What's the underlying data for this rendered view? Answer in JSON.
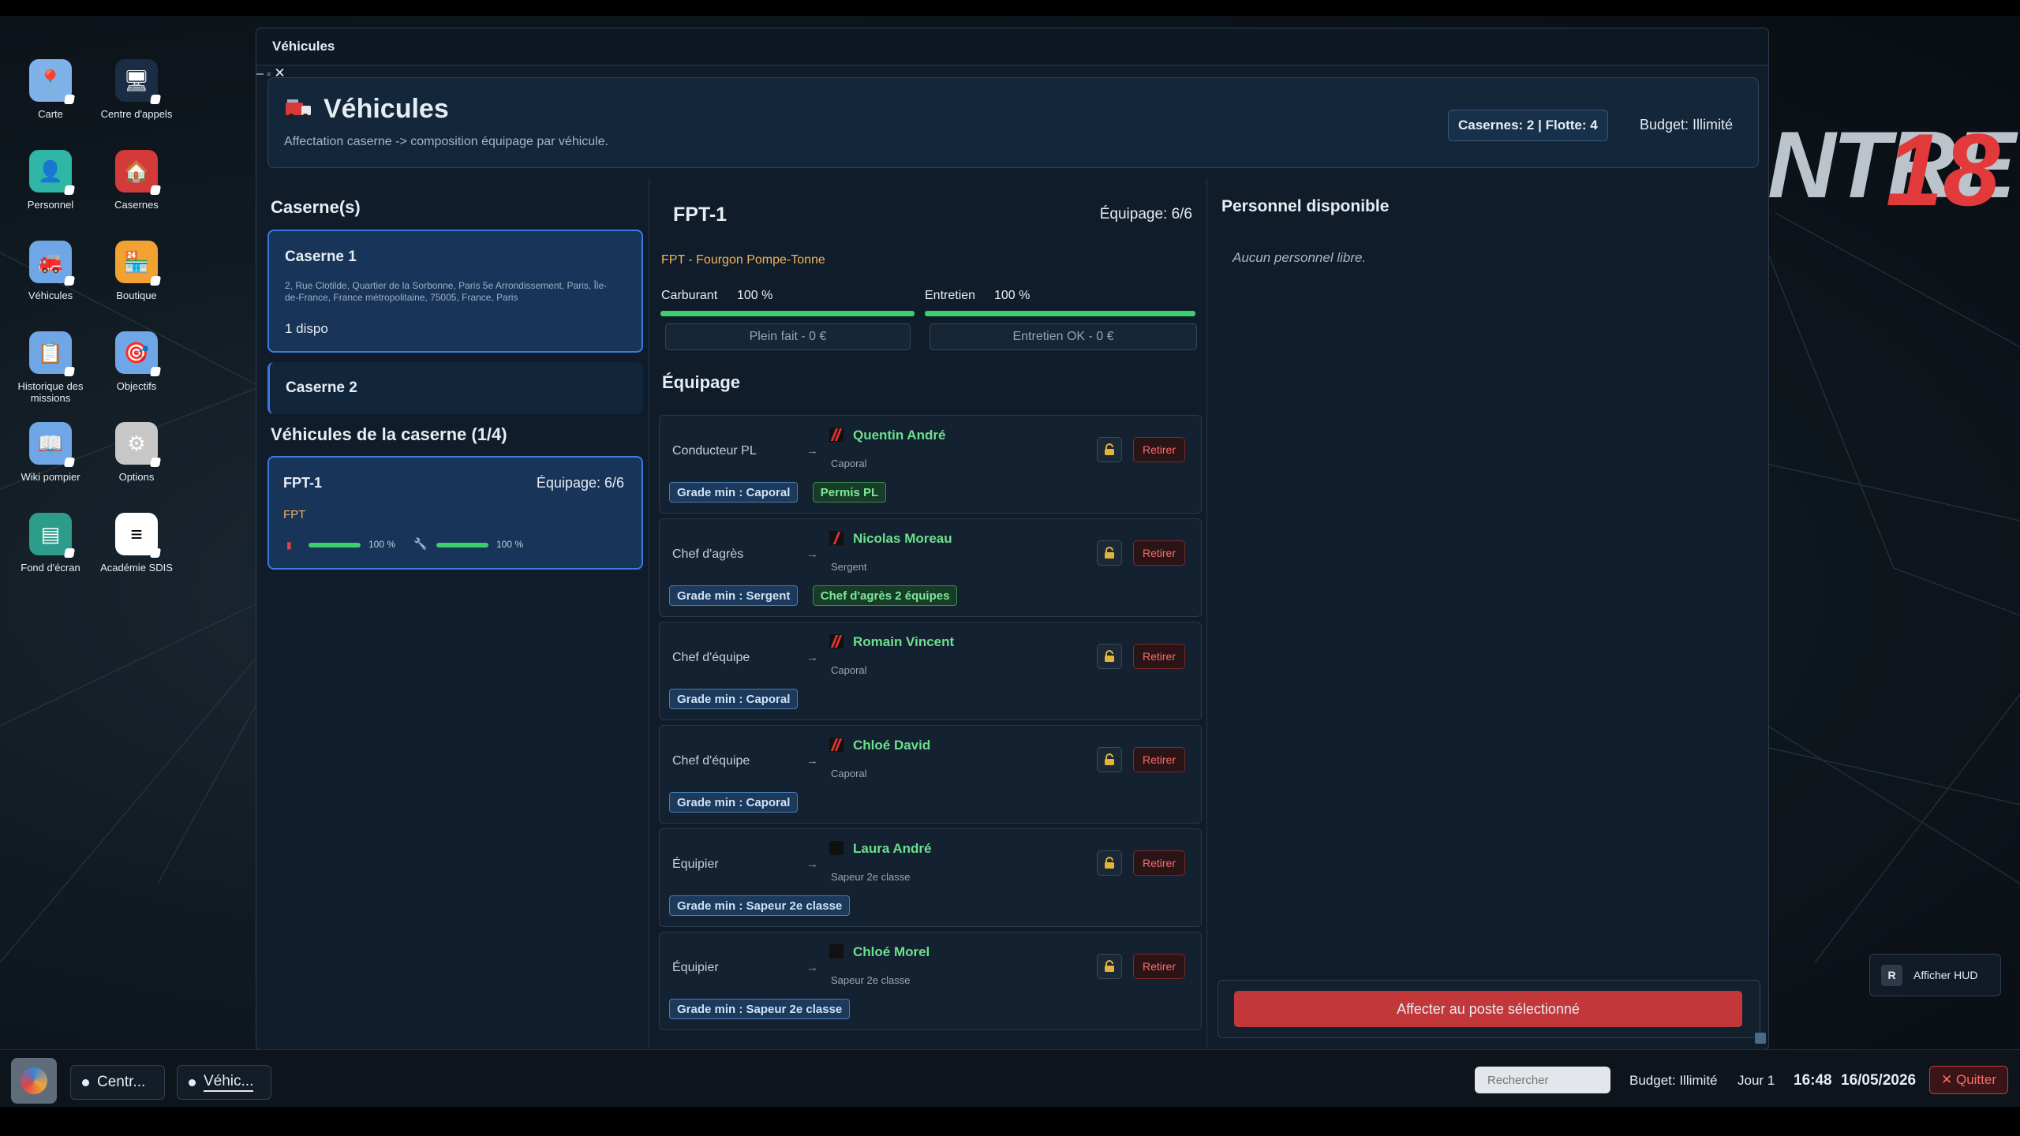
{
  "desktop": {
    "brand_text": "NTRE",
    "brand_num": "18",
    "icons": [
      {
        "label": "Carte",
        "icon": "map-icon"
      },
      {
        "label": "Centre d'appels",
        "icon": "call-center-icon"
      },
      {
        "label": "Personnel",
        "icon": "personnel-icon"
      },
      {
        "label": "Casernes",
        "icon": "firestation-icon"
      },
      {
        "label": "Véhicules",
        "icon": "vehicles-icon"
      },
      {
        "label": "Boutique",
        "icon": "shop-icon"
      },
      {
        "label": "Historique des missions",
        "icon": "history-icon"
      },
      {
        "label": "Objectifs",
        "icon": "objectives-icon"
      },
      {
        "label": "Wiki pompier",
        "icon": "wiki-icon"
      },
      {
        "label": "Options",
        "icon": "gear-icon"
      },
      {
        "label": "Fond d'écran",
        "icon": "wallpaper-icon"
      },
      {
        "label": "Académie SDIS",
        "icon": "academy-icon"
      }
    ]
  },
  "window": {
    "title": "Véhicules",
    "header_title": "Véhicules",
    "header_subtitle": "Affectation caserne -> composition équipage par véhicule.",
    "counts": "Casernes: 2 | Flotte: 4",
    "budget": "Budget: Illimité"
  },
  "stations": {
    "heading": "Caserne(s)",
    "items": [
      {
        "name": "Caserne 1",
        "address": "2, Rue Clotilde, Quartier de la Sorbonne, Paris 5e Arrondissement, Paris, Île-de-France, France métropolitaine, 75005, France, Paris",
        "available": "1 dispo"
      },
      {
        "name": "Caserne 2"
      }
    ]
  },
  "vehicles": {
    "heading": "Véhicules de la caserne (1/4)",
    "items": [
      {
        "name": "FPT-1",
        "crew": "Équipage: 6/6",
        "type": "FPT",
        "fuel_pct": "100 %",
        "maint_pct": "100 %",
        "fuel_level": 1.0,
        "maint_level": 1.0
      }
    ]
  },
  "detail": {
    "name": "FPT-1",
    "crew": "Équipage: 6/6",
    "type_full": "FPT - Fourgon Pompe-Tonne",
    "fuel_label": "Carburant",
    "fuel_pct": "100 %",
    "fuel_level": 1.0,
    "maint_label": "Entretien",
    "maint_pct": "100 %",
    "maint_level": 1.0,
    "refuel_btn": "Plein fait - 0 €",
    "maint_btn": "Entretien OK - 0 €",
    "crew_heading": "Équipage",
    "remove_label": "Retirer",
    "slots": [
      {
        "role": "Conducteur PL",
        "name": "Quentin André",
        "grade": "Caporal",
        "tags": [
          "Grade min : Caporal",
          "Permis PL"
        ]
      },
      {
        "role": "Chef d'agrès",
        "name": "Nicolas Moreau",
        "grade": "Sergent",
        "tags": [
          "Grade min : Sergent",
          "Chef d'agrès 2 équipes"
        ]
      },
      {
        "role": "Chef d'équipe",
        "name": "Romain Vincent",
        "grade": "Caporal",
        "tags": [
          "Grade min : Caporal"
        ]
      },
      {
        "role": "Chef d'équipe",
        "name": "Chloé David",
        "grade": "Caporal",
        "tags": [
          "Grade min : Caporal"
        ]
      },
      {
        "role": "Équipier",
        "name": "Laura André",
        "grade": "Sapeur 2e classe",
        "tags": [
          "Grade min : Sapeur 2e classe"
        ]
      },
      {
        "role": "Équipier",
        "name": "Chloé Morel",
        "grade": "Sapeur 2e classe",
        "tags": [
          "Grade min : Sapeur 2e classe"
        ]
      }
    ]
  },
  "available": {
    "heading": "Personnel disponible",
    "empty": "Aucun personnel libre.",
    "assign_btn": "Affecter au poste sélectionné"
  },
  "hud": {
    "key": "R",
    "label": "Afficher HUD"
  },
  "taskbar": {
    "tasks": [
      "Centr...",
      "Véhic..."
    ],
    "search_placeholder": "Rechercher",
    "budget": "Budget: Illimité",
    "day": "Jour 1",
    "time": "16:48",
    "date": "16/05/2026",
    "quit": "✕ Quitter"
  },
  "colors": {
    "accent": "#3a7be0",
    "green": "#3ccf6e",
    "danger": "#c9393c"
  }
}
